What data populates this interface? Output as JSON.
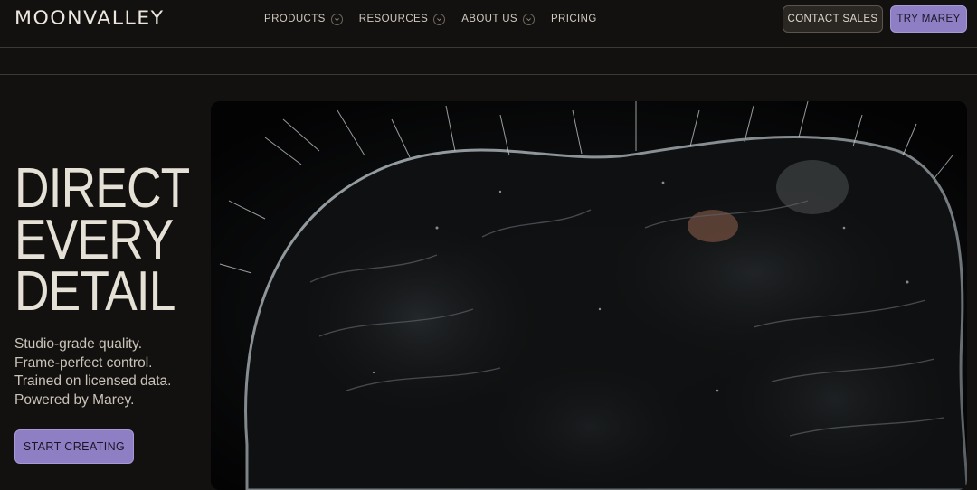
{
  "brand": {
    "logo_text": "MOONVALLEY"
  },
  "nav": {
    "items": [
      {
        "label": "PRODUCTS",
        "has_dropdown": true
      },
      {
        "label": "RESOURCES",
        "has_dropdown": true
      },
      {
        "label": "ABOUT US",
        "has_dropdown": true
      },
      {
        "label": "PRICING",
        "has_dropdown": false
      }
    ]
  },
  "header_actions": {
    "contact_label": "CONTACT SALES",
    "try_label": "TRY MAREY"
  },
  "hero": {
    "headline": [
      "DIRECT",
      "EVERY",
      "DETAIL"
    ],
    "lines": [
      "Studio-grade quality.",
      "Frame-perfect control.",
      "Trained on licensed data.",
      "Powered by Marey."
    ],
    "cta_label": "START CREATING",
    "media_icon": "close-up-creature-image"
  },
  "colors": {
    "background": "#13110f",
    "accent": "#8e7fc4",
    "text": "#e6e1d6"
  }
}
